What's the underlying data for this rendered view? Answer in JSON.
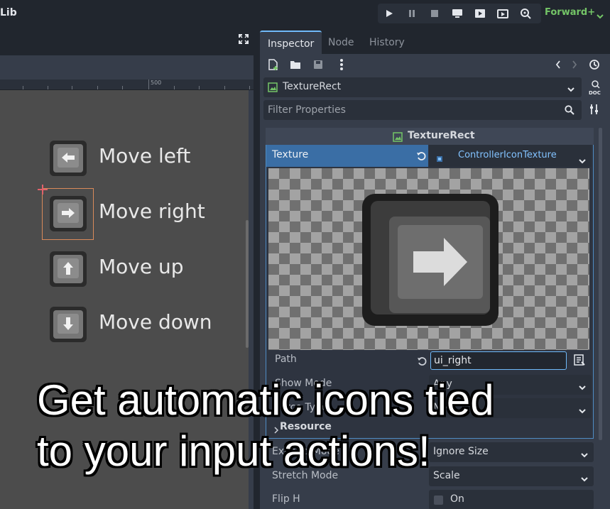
{
  "app": {
    "title_fragment": "Lib",
    "renderer": "Forward+"
  },
  "toolbar": {
    "buttons": [
      "play-icon",
      "pause-icon",
      "stop-icon",
      "remote-debug-icon",
      "play-scene-icon",
      "play-custom-icon",
      "movie-icon"
    ]
  },
  "viewport": {
    "ruler_label": "500",
    "actions": [
      {
        "label": "Move left",
        "icon": "arrow-left-icon"
      },
      {
        "label": "Move right",
        "icon": "arrow-right-icon"
      },
      {
        "label": "Move up",
        "icon": "arrow-up-icon"
      },
      {
        "label": "Move down",
        "icon": "arrow-down-icon"
      }
    ]
  },
  "inspector": {
    "tabs": [
      "Inspector",
      "Node",
      "History"
    ],
    "active_tab": "Inspector",
    "object_name": "TextureRect",
    "filter_placeholder": "Filter Properties",
    "section_title": "TextureRect",
    "texture_label": "Texture",
    "texture_value": "ControllerIconTexture",
    "path_label": "Path",
    "path_value": "ui_right",
    "show_mode_label": "Show Mode",
    "show_mode_value": "Any",
    "force_type_label": "Force Type",
    "force_type_value": "No",
    "resource_label": "Resource",
    "expand_mode_label": "Expand Mode",
    "expand_mode_value": "Ignore Size",
    "stretch_mode_label": "Stretch Mode",
    "stretch_mode_value": "Scale",
    "flip_h_label": "Flip H",
    "flip_h_value": "On"
  },
  "caption": {
    "line1": "Get automatic icons tied",
    "line2": "to your input actions!"
  }
}
